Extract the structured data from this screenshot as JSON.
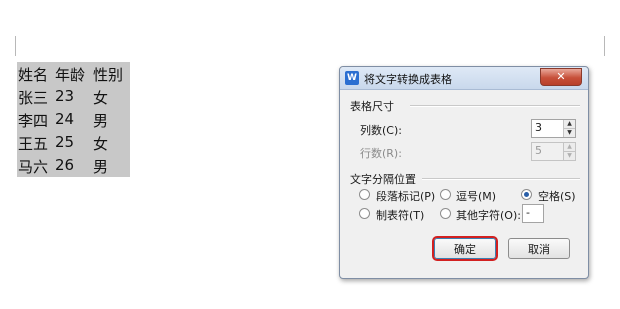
{
  "document": {
    "rows": [
      [
        "姓名",
        "年龄",
        "性别"
      ],
      [
        "张三",
        "23",
        "女"
      ],
      [
        "李四",
        "24",
        "男"
      ],
      [
        "王五",
        "25",
        "女"
      ],
      [
        "马六",
        "26",
        "男"
      ]
    ]
  },
  "dialog": {
    "title": "将文字转换成表格",
    "app_icon": "W",
    "table_size": {
      "section_title": "表格尺寸",
      "columns_label": "列数(C):",
      "columns_value": "3",
      "rows_label": "行数(R):",
      "rows_value": "5"
    },
    "separator": {
      "section_title": "文字分隔位置",
      "options": [
        {
          "label": "段落标记(P)",
          "checked": false
        },
        {
          "label": "逗号(M)",
          "checked": false
        },
        {
          "label": "空格(S)",
          "checked": true
        },
        {
          "label": "制表符(T)",
          "checked": false
        },
        {
          "label": "其他字符(O):",
          "checked": false
        }
      ],
      "other_char": "-"
    },
    "ok_label": "确定",
    "cancel_label": "取消"
  },
  "colors": {
    "selection_highlight": "#c8c8c8",
    "ok_highlight_border": "#d22020"
  }
}
